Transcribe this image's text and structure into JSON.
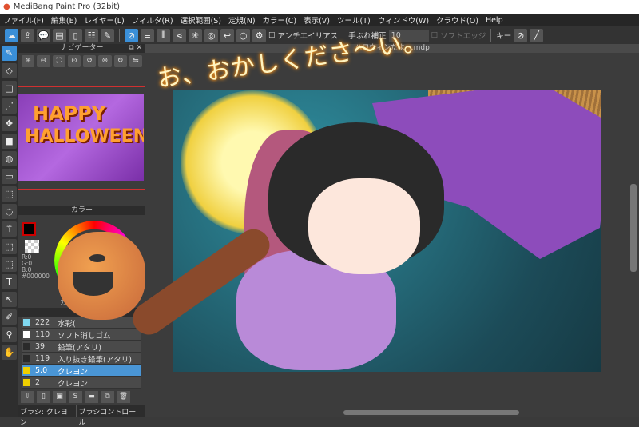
{
  "title": "MediBang Paint Pro (32bit)",
  "menu": [
    "ファイル(F)",
    "編集(E)",
    "レイヤー(L)",
    "フィルタ(R)",
    "選択範囲(S)",
    "定規(N)",
    "カラー(C)",
    "表示(V)",
    "ツール(T)",
    "ウィンドウ(W)",
    "クラウド(O)",
    "Help"
  ],
  "toolbar": {
    "antialias": "アンチエイリアス",
    "stabilizer_label": "手ぶれ補正",
    "stabilizer_value": "10",
    "soft_edge": "ソフトエッジ",
    "key": "キー"
  },
  "navigator": {
    "title": "ナビゲーター",
    "preview_line1": "HAPPY",
    "preview_line2": "HALLOWEEN"
  },
  "color": {
    "title": "カラー",
    "r": "R:0",
    "g": "G:0",
    "b": "B:0",
    "hex": "#000000",
    "tab": "カラ"
  },
  "brushes": {
    "title": "ブ",
    "items": [
      {
        "size": "222",
        "name": "水彩(",
        "color": "#7fd8f0"
      },
      {
        "size": "110",
        "name": "ソフト消しゴム",
        "color": "#ffffff"
      },
      {
        "size": "39",
        "name": "鉛筆(アタリ)",
        "color": "#2a2a2a"
      },
      {
        "size": "119",
        "name": "入り抜き鉛筆(アタリ)",
        "color": "#2a2a2a"
      },
      {
        "size": "5.0",
        "name": "クレヨン",
        "color": "#f0d000",
        "selected": true
      },
      {
        "size": "2",
        "name": "クレヨン",
        "color": "#f0d000"
      }
    ]
  },
  "bottom_tabs": [
    "ブラシ: クレヨン",
    "ブラシコントロール"
  ],
  "document": {
    "tab": "ハロウィンだよ~.mdp",
    "caption": "お、おかしくださ〜い。"
  }
}
